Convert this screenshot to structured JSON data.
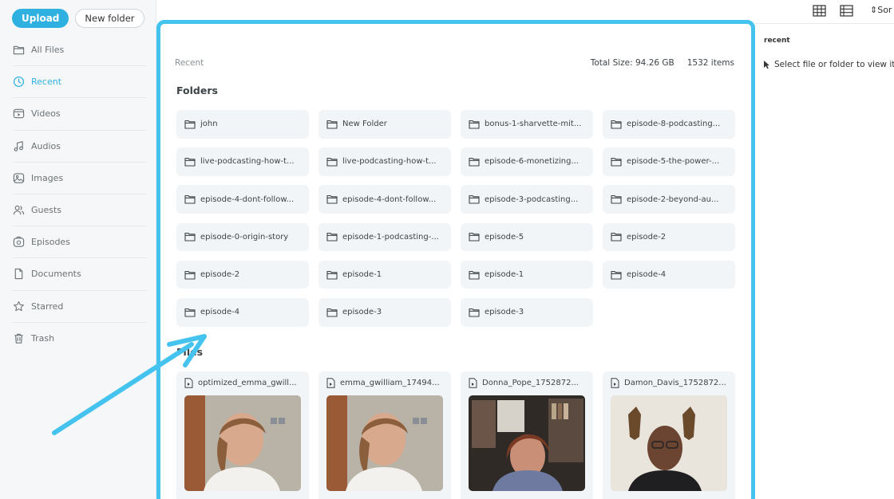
{
  "sidebar": {
    "upload_label": "Upload",
    "new_folder_label": "New folder",
    "items": [
      {
        "label": "All Files",
        "icon": "folder-icon",
        "active": false
      },
      {
        "label": "Recent",
        "icon": "clock-icon",
        "active": true
      },
      {
        "label": "Videos",
        "icon": "video-icon",
        "active": false
      },
      {
        "label": "Audios",
        "icon": "music-icon",
        "active": false
      },
      {
        "label": "Images",
        "icon": "image-icon",
        "active": false
      },
      {
        "label": "Guests",
        "icon": "users-icon",
        "active": false
      },
      {
        "label": "Episodes",
        "icon": "podcast-icon",
        "active": false
      },
      {
        "label": "Documents",
        "icon": "document-icon",
        "active": false
      },
      {
        "label": "Starred",
        "icon": "star-icon",
        "active": false
      },
      {
        "label": "Trash",
        "icon": "trash-icon",
        "active": false
      }
    ]
  },
  "main": {
    "breadcrumb": "Recent",
    "total_size": "Total Size: 94.26 GB",
    "item_count": "1532 items",
    "folders_title": "Folders",
    "files_title": "Files",
    "folders": [
      "john",
      "New Folder",
      "bonus-1-sharvette-mit...",
      "episode-8-podcasting...",
      "live-podcasting-how-t...",
      "live-podcasting-how-t...",
      "episode-6-monetizing...",
      "episode-5-the-power-...",
      "episode-4-dont-follow...",
      "episode-4-dont-follow...",
      "episode-3-podcasting...",
      "episode-2-beyond-au...",
      "episode-0-origin-story",
      "episode-1-podcasting-...",
      "episode-5",
      "episode-2",
      "episode-2",
      "episode-1",
      "episode-1",
      "episode-4",
      "episode-4",
      "episode-3",
      "episode-3"
    ],
    "files": [
      {
        "name": "optimized_emma_gwill..."
      },
      {
        "name": "emma_gwilliam_17494..."
      },
      {
        "name": "Donna_Pope_1752872..."
      },
      {
        "name": "Damon_Davis_1752872..."
      }
    ]
  },
  "right": {
    "sort_label": "Sor",
    "title": "recent",
    "hint": "Select file or folder to view its"
  },
  "colors": {
    "accent": "#2eb0e0",
    "highlight_border": "#44c3ef",
    "arrow": "#44c3ef"
  }
}
